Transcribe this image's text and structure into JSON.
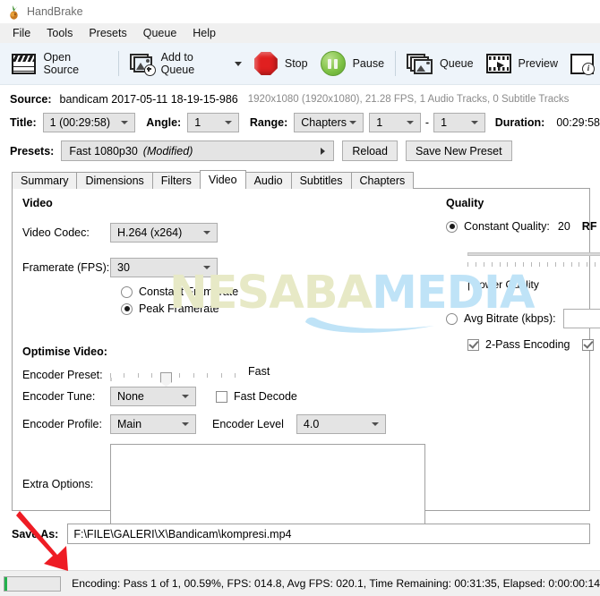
{
  "window": {
    "title": "HandBrake",
    "icon": "handbrake-pineapple-icon"
  },
  "menu": {
    "items": [
      "File",
      "Tools",
      "Presets",
      "Queue",
      "Help"
    ]
  },
  "toolbar": {
    "open_source": "Open Source",
    "add_to_queue": "Add to Queue",
    "stop": "Stop",
    "pause": "Pause",
    "queue": "Queue",
    "preview": "Preview",
    "activity_log_icon": "activity-log-icon"
  },
  "source": {
    "label": "Source:",
    "name": "bandicam 2017-05-11 18-19-15-986",
    "meta": "1920x1080 (1920x1080), 21.28 FPS, 1 Audio Tracks, 0 Subtitle Tracks"
  },
  "title_row": {
    "title_label": "Title:",
    "title_value": "1 (00:29:58)",
    "angle_label": "Angle:",
    "angle_value": "1",
    "range_label": "Range:",
    "range_value": "Chapters",
    "chapter_start": "1",
    "dash": "-",
    "chapter_end": "1",
    "duration_label": "Duration:",
    "duration_value": "00:29:58"
  },
  "presets": {
    "label": "Presets:",
    "value": "Fast 1080p30",
    "modified": "(Modified)",
    "reload": "Reload",
    "save_new_preset": "Save New Preset"
  },
  "tabs": {
    "items": [
      "Summary",
      "Dimensions",
      "Filters",
      "Video",
      "Audio",
      "Subtitles",
      "Chapters"
    ],
    "selected": "Video"
  },
  "video": {
    "section_title": "Video",
    "codec_label": "Video Codec:",
    "codec_value": "H.264 (x264)",
    "framerate_label": "Framerate (FPS):",
    "framerate_value": "30",
    "constant_framerate": "Constant Framerate",
    "peak_framerate": "Peak Framerate",
    "framerate_mode_selected": "Peak Framerate",
    "optimise_title": "Optimise Video:",
    "encoder_preset_label": "Encoder Preset:",
    "encoder_preset_value": "Fast",
    "encoder_tune_label": "Encoder Tune:",
    "encoder_tune_value": "None",
    "fast_decode_label": "Fast Decode",
    "fast_decode_checked": false,
    "encoder_profile_label": "Encoder Profile:",
    "encoder_profile_value": "Main",
    "encoder_level_label": "Encoder Level",
    "encoder_level_value": "4.0",
    "extra_options_label": "Extra Options:",
    "extra_options_value": ""
  },
  "quality": {
    "section_title": "Quality",
    "constant_quality_label": "Constant Quality:",
    "constant_quality_value": "20",
    "rf_label": "RF",
    "lower_quality_label": "| Lower Quality",
    "avg_bitrate_label": "Avg Bitrate (kbps):",
    "avg_bitrate_value": "",
    "two_pass_label": "2-Pass Encoding",
    "two_pass_checked": true,
    "mode_selected": "Constant Quality"
  },
  "save_as": {
    "label": "Save As:",
    "value": "F:\\FILE\\GALERI\\X\\Bandicam\\kompresi.mp4"
  },
  "status": {
    "progress_percent": 0.59,
    "text": "Encoding: Pass 1 of 1,  00.59%, FPS: 014.8,  Avg FPS: 020.1,  Time Remaining: 00:31:35,  Elapsed: 0:00:00:14"
  },
  "watermark": {
    "part1": "NESABA",
    "part2": "MEDIA"
  },
  "annotation": {
    "arrow": "red-arrow-pointing-to-progress-bar"
  },
  "colors": {
    "toolbar_bg": "#eef4fa",
    "menu_bg": "#f0f0f0",
    "accent_stop": "#e02020",
    "accent_pause": "#7cc043",
    "progress_fill": "#22b14c",
    "arrow": "#ee1c24",
    "watermark_a": "#e7e9c6",
    "watermark_b": "#bfe3f7"
  }
}
